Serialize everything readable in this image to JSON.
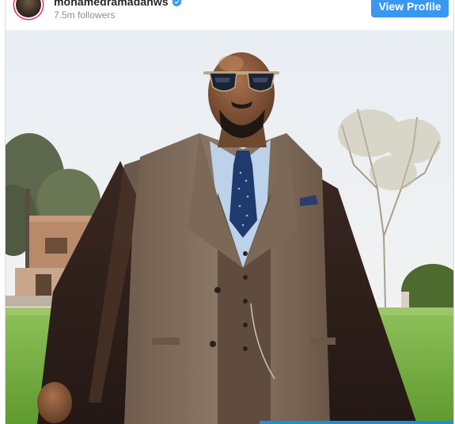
{
  "profile": {
    "username": "mohamedramadanws",
    "followers": "7.5m followers",
    "view_profile_label": "View Profile",
    "verified": true
  },
  "post": {
    "image": "man in brown three-piece suit and aviator sunglasses with cape over shoulders, outdoors on grass with trees and building behind",
    "icons": [
      "verified-badge-icon",
      "avatar"
    ]
  },
  "colors": {
    "accent": "#3897f0",
    "verified": "#3897f0",
    "progress": "#1a8fd6"
  }
}
